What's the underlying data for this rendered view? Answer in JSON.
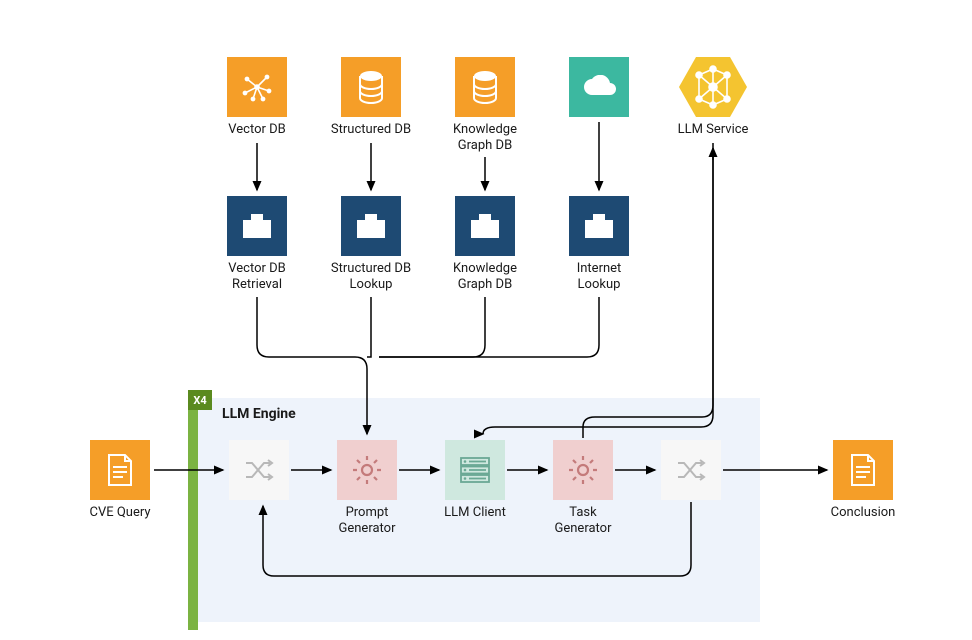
{
  "top": {
    "vector_db": "Vector DB",
    "structured_db": "Structured DB",
    "knowledge_graph_db": "Knowledge\nGraph DB",
    "cloud": "",
    "llm_service": "LLM Service"
  },
  "lookup": {
    "vector_db_retrieval": "Vector DB\nRetrieval",
    "structured_db_lookup": "Structured DB\nLookup",
    "knowledge_graph_db": "Knowledge\nGraph DB",
    "internet_lookup": "Internet\nLookup"
  },
  "engine": {
    "badge": "X4",
    "title": "LLM Engine",
    "prompt_generator": "Prompt\nGenerator",
    "llm_client": "LLM Client",
    "task_generator": "Task\nGenerator"
  },
  "left": {
    "cve_query": "CVE Query"
  },
  "right": {
    "conclusion": "Conclusion"
  }
}
